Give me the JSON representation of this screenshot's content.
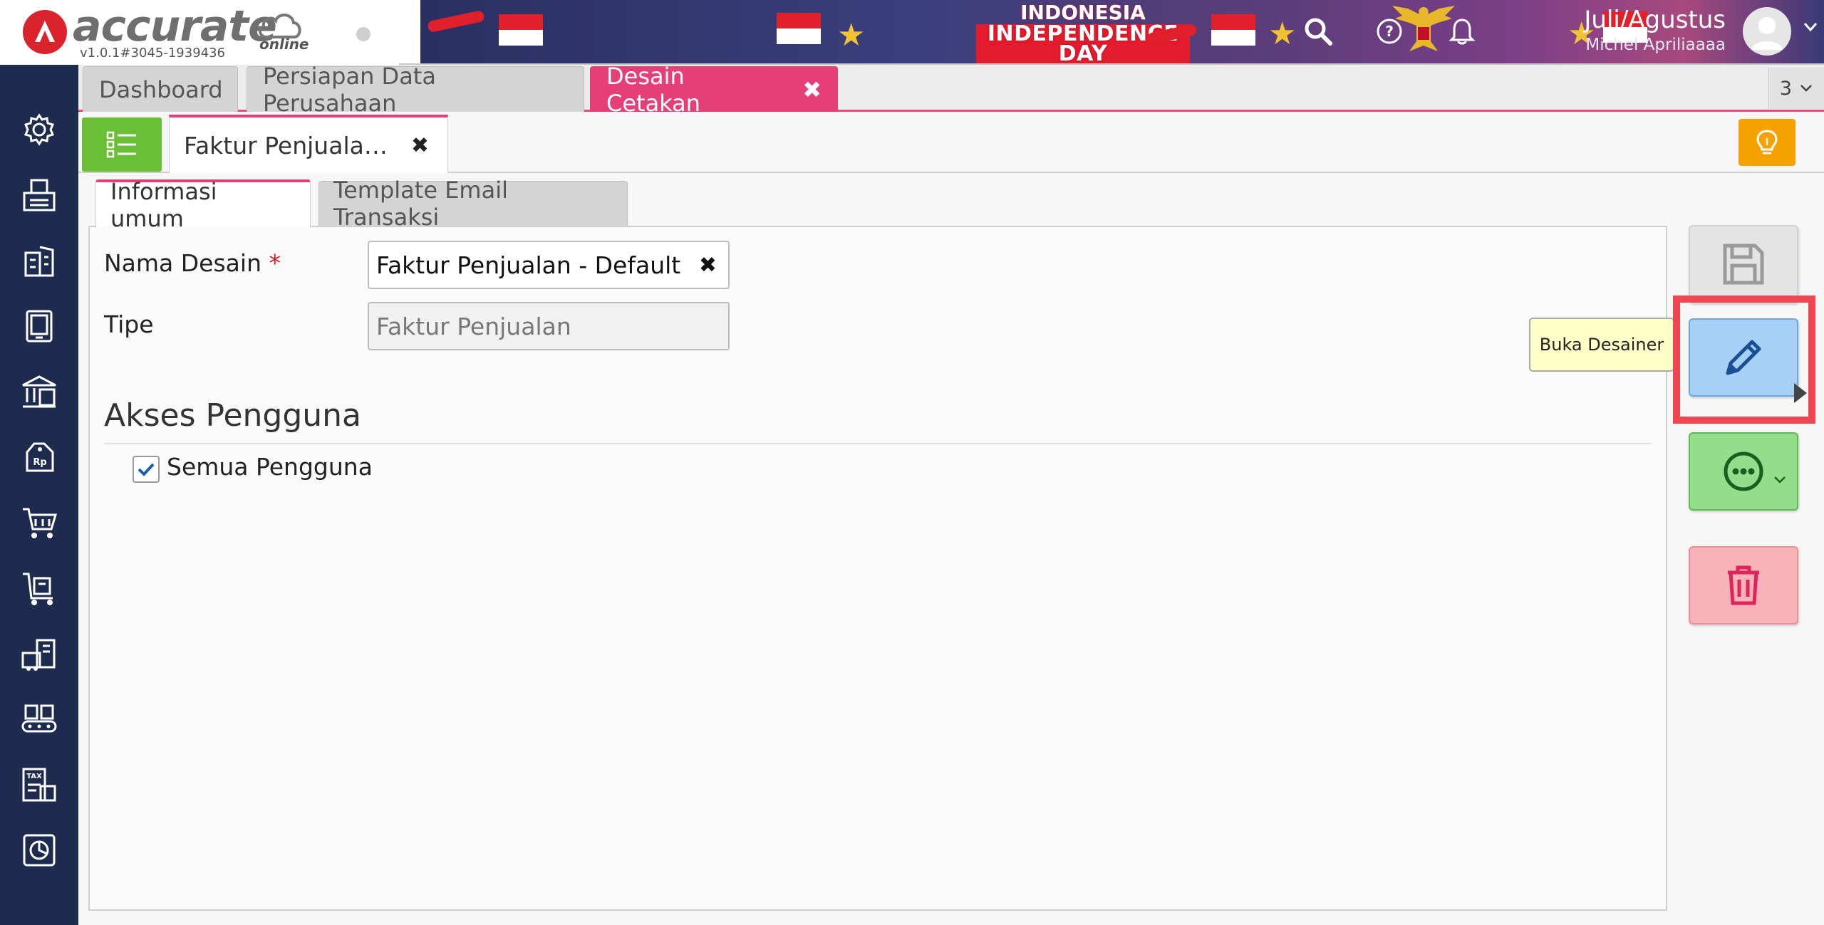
{
  "app": {
    "logo_text": "accurate",
    "logo_sub": "online",
    "version": "v1.0.1#3045-1939436"
  },
  "banner": {
    "line1": "INDONESIA",
    "line2": "INDEPENDENCE DAY"
  },
  "header": {
    "period": "Juli/Agustus",
    "user": "Michel Apriliaaaa",
    "icons": [
      "search-icon",
      "help-icon",
      "bell-icon",
      "avatar-icon",
      "chevron-down-icon"
    ]
  },
  "sidebar": {
    "items": [
      "gear-icon",
      "fax-icon",
      "building-icon",
      "ledger-icon",
      "bank-icon",
      "price-tag-icon",
      "cart-icon",
      "purchase-cart-icon",
      "warehouse-icon",
      "conveyor-icon",
      "tax-icon",
      "report-icon"
    ]
  },
  "module_tabs": {
    "items": [
      {
        "label": "Dashboard"
      },
      {
        "label": "Persiapan Data Perusahaan"
      },
      {
        "label": "Desain Cetakan"
      }
    ],
    "active": "Desain Cetakan",
    "count": "3"
  },
  "doc_tabs": {
    "active_label": "Faktur Penjuala…"
  },
  "inner_tabs": {
    "items": [
      {
        "label": "Informasi umum"
      },
      {
        "label": "Template Email Transaksi"
      }
    ]
  },
  "form": {
    "name_label": "Nama Desain",
    "required_mark": "*",
    "name_value": "Faktur Penjualan - Default",
    "type_label": "Tipe",
    "type_placeholder": "Faktur Penjualan",
    "section_title": "Akses Pengguna",
    "checkbox_label": "Semua Pengguna",
    "checkbox_checked": true
  },
  "actions": {
    "tooltip": "Buka Desainer",
    "colors": {
      "save": "#e4e4e4",
      "edit": "#a7d0f6",
      "more": "#94dd8c",
      "delete": "#f7b3b8",
      "highlight": "#f24552"
    }
  },
  "colors": {
    "accent": "#e53f77",
    "sidebar": "#1d2b4f",
    "list_button": "#6bbf35",
    "bulb_button": "#f5a100"
  }
}
